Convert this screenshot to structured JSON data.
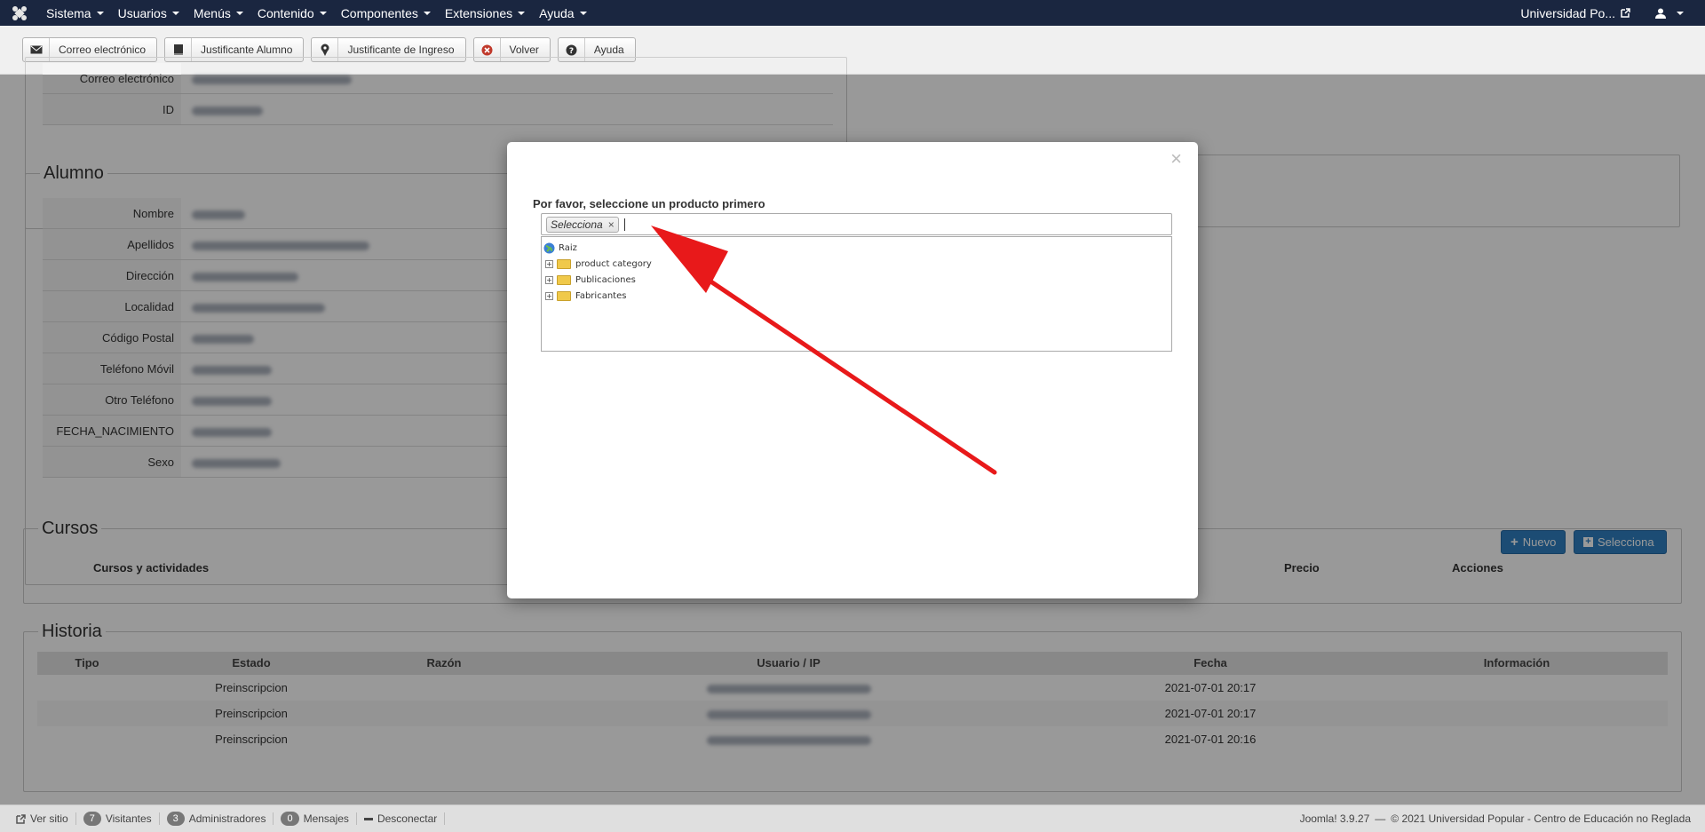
{
  "topbar": {
    "menu": [
      {
        "label": "Sistema"
      },
      {
        "label": "Usuarios"
      },
      {
        "label": "Menús"
      },
      {
        "label": "Contenido"
      },
      {
        "label": "Componentes"
      },
      {
        "label": "Extensiones"
      },
      {
        "label": "Ayuda"
      }
    ],
    "site_link": "Universidad Po...",
    "user_icon": "user-icon"
  },
  "toolbar": {
    "buttons": [
      {
        "label": "Correo electrónico",
        "icon": "envelope-icon"
      },
      {
        "label": "Justificante Alumno",
        "icon": "book-icon"
      },
      {
        "label": "Justificante de Ingreso",
        "icon": "pin-icon"
      },
      {
        "label": "Volver",
        "icon": "cancel-icon"
      },
      {
        "label": "Ayuda",
        "icon": "question-icon"
      }
    ]
  },
  "top_section": {
    "rows": [
      {
        "label": "Correo electrónico"
      },
      {
        "label": "ID"
      }
    ]
  },
  "alumno": {
    "legend": "Alumno",
    "rows": [
      {
        "label": "Nombre"
      },
      {
        "label": "Apellidos"
      },
      {
        "label": "Dirección"
      },
      {
        "label": "Localidad"
      },
      {
        "label": "Código Postal"
      },
      {
        "label": "Teléfono Móvil"
      },
      {
        "label": "Otro Teléfono"
      },
      {
        "label": "FECHA_NACIMIENTO"
      },
      {
        "label": "Sexo"
      }
    ]
  },
  "cursos": {
    "legend": "Cursos",
    "new_button": "Nuevo",
    "select_button": "Selecciona",
    "columns": [
      "Cursos y actividades",
      "Precio",
      "Acciones"
    ]
  },
  "historia": {
    "legend": "Historia",
    "columns": [
      "Tipo",
      "Estado",
      "Razón",
      "Usuario / IP",
      "Fecha",
      "Información"
    ],
    "rows": [
      {
        "estado": "Preinscripcion",
        "fecha": "2021-07-01 20:17"
      },
      {
        "estado": "Preinscripcion",
        "fecha": "2021-07-01 20:17"
      },
      {
        "estado": "Preinscripcion",
        "fecha": "2021-07-01 20:16"
      }
    ]
  },
  "modal": {
    "close": "×",
    "title": "Por favor, seleccione un producto primero",
    "chip": "Selecciona",
    "chip_remove": "×",
    "tree": {
      "root": "Raiz",
      "items": [
        "product category",
        "Publicaciones",
        "Fabricantes"
      ],
      "expander": "+"
    }
  },
  "footer": {
    "view_site": "Ver sitio",
    "visitors_count": "7",
    "visitors": "Visitantes",
    "admins_count": "3",
    "admins": "Administradores",
    "messages_count": "0",
    "messages": "Mensajes",
    "logout": "Desconectar",
    "version": "Joomla! 3.9.27",
    "dash": "—",
    "copyright": "© 2021 Universidad Popular - Centro de Educación no Reglada"
  },
  "colors": {
    "topbar": "#1a2640",
    "primary_button": "#2f7fc1",
    "arrow": "#e8191a"
  }
}
